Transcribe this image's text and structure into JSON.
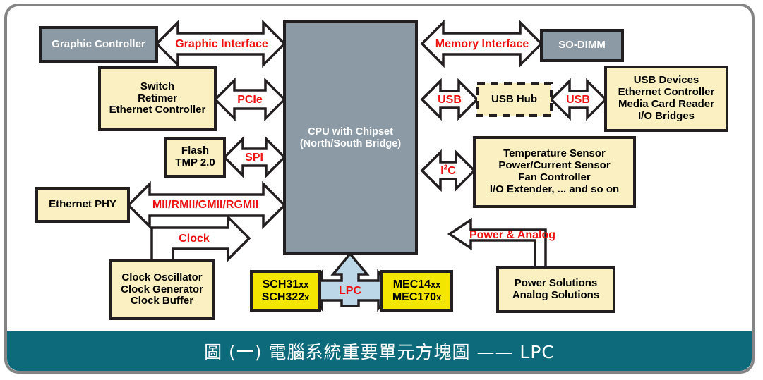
{
  "diagram": {
    "title_footer": "圖 (一) 電腦系統重要單元方塊圖 —— LPC",
    "colors": {
      "frame_border": "#848484",
      "footer_bg": "#0d6a7b",
      "gray_box": "#8b9aa4",
      "cream_box": "#faf0c2",
      "yellow_box": "#f3e600",
      "box_border": "#231f20",
      "label_red": "#ee1111",
      "lpc_arrow": "#bcd7e8"
    },
    "boxes": {
      "graphic_controller": {
        "lines": [
          "Graphic Controller"
        ],
        "style": "gray"
      },
      "switch_retimer": {
        "lines": [
          "Switch",
          "Retimer",
          "Ethernet Controller"
        ],
        "style": "cream"
      },
      "flash_tmp": {
        "lines": [
          "Flash",
          "TMP 2.0"
        ],
        "style": "cream"
      },
      "ethernet_phy": {
        "lines": [
          "Ethernet PHY"
        ],
        "style": "cream"
      },
      "clock_sources": {
        "lines": [
          "Clock Oscillator",
          "Clock Generator",
          "Clock Buffer"
        ],
        "style": "cream"
      },
      "cpu_chipset": {
        "lines": [
          "CPU with Chipset",
          "(North/South Bridge)"
        ],
        "style": "gray"
      },
      "so_dimm": {
        "lines": [
          "SO-DIMM"
        ],
        "style": "gray"
      },
      "usb_hub": {
        "lines": [
          "USB Hub"
        ],
        "style": "cream-dashed"
      },
      "usb_devices": {
        "lines": [
          "USB Devices",
          "Ethernet Controller",
          "Media Card Reader",
          "I/O Bridges"
        ],
        "style": "cream"
      },
      "sensors": {
        "lines": [
          "Temperature Sensor",
          "Power/Current Sensor",
          "Fan Controller",
          "I/O Extender, ... and so on"
        ],
        "style": "cream"
      },
      "power_solutions": {
        "lines": [
          "Power Solutions",
          "Analog Solutions"
        ],
        "style": "cream"
      },
      "sch_parts": {
        "lines": [
          "SCH31xx",
          "SCH322x"
        ],
        "style": "yellow"
      },
      "mec_parts": {
        "lines": [
          "MEC14xx",
          "MEC170x"
        ],
        "style": "yellow"
      }
    },
    "bus_labels": {
      "graphic_interface": "Graphic Interface",
      "pcie": "PCIe",
      "spi": "SPI",
      "mii": "MII/RMII/GMII/RGMII",
      "clock": "Clock",
      "memory_interface": "Memory Interface",
      "usb_left": "USB",
      "usb_right": "USB",
      "i2c": "I2C",
      "power_analog": "Power & Analog",
      "lpc": "LPC"
    }
  }
}
